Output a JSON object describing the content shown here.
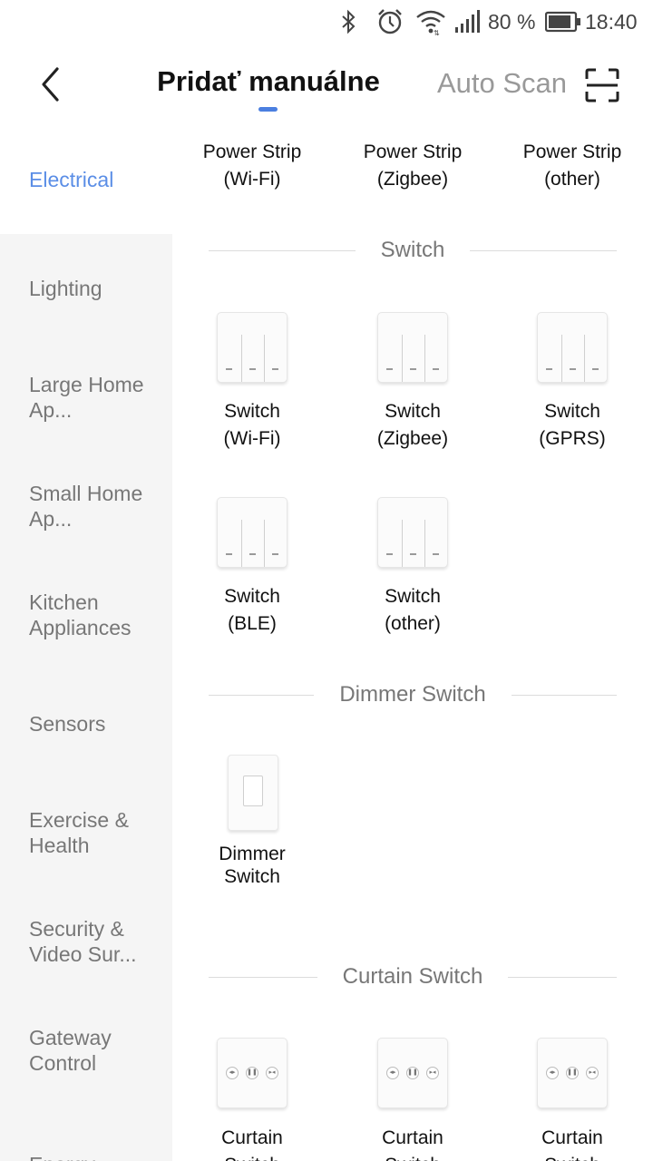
{
  "status_bar": {
    "battery_percent": "80 %",
    "time": "18:40",
    "icons": [
      "bluetooth-icon",
      "alarm-icon",
      "wifi-icon",
      "signal-icon",
      "battery-icon"
    ]
  },
  "header": {
    "back_icon": "chevron-left-icon",
    "tab_manual": "Pridať manuálne",
    "tab_auto": "Auto Scan",
    "scan_icon": "scan-icon",
    "active_tab_color": "#4b7fe0"
  },
  "sidebar": {
    "active_color": "#5b8ee6",
    "items": [
      {
        "label": "Electrical"
      },
      {
        "label": "Lighting"
      },
      {
        "label": "Large Home Ap..."
      },
      {
        "label": "Small Home Ap..."
      },
      {
        "label": "Kitchen Appliances"
      },
      {
        "label": "Sensors"
      },
      {
        "label": "Exercise & Health"
      },
      {
        "label": "Security & Video Sur..."
      },
      {
        "label": "Gateway Control"
      },
      {
        "label": "Energy"
      }
    ]
  },
  "content": {
    "power_strip": [
      {
        "line1": "Power Strip",
        "line2": "(Wi-Fi)"
      },
      {
        "line1": "Power Strip",
        "line2": "(Zigbee)"
      },
      {
        "line1": "Power Strip",
        "line2": "(other)"
      }
    ],
    "section_switch": "Switch",
    "switches": [
      {
        "line1": "Switch",
        "line2": "(Wi-Fi)"
      },
      {
        "line1": "Switch",
        "line2": "(Zigbee)"
      },
      {
        "line1": "Switch",
        "line2": "(GPRS)"
      },
      {
        "line1": "Switch",
        "line2": "(BLE)"
      },
      {
        "line1": "Switch",
        "line2": "(other)"
      }
    ],
    "section_dimmer": "Dimmer Switch",
    "dimmer": {
      "line1": "Dimmer",
      "line2": "Switch"
    },
    "section_curtain": "Curtain Switch",
    "curtains": [
      {
        "line1": "Curtain",
        "line2": "Switch"
      },
      {
        "line1": "Curtain",
        "line2": "Switch"
      },
      {
        "line1": "Curtain",
        "line2": "Switch"
      }
    ]
  }
}
